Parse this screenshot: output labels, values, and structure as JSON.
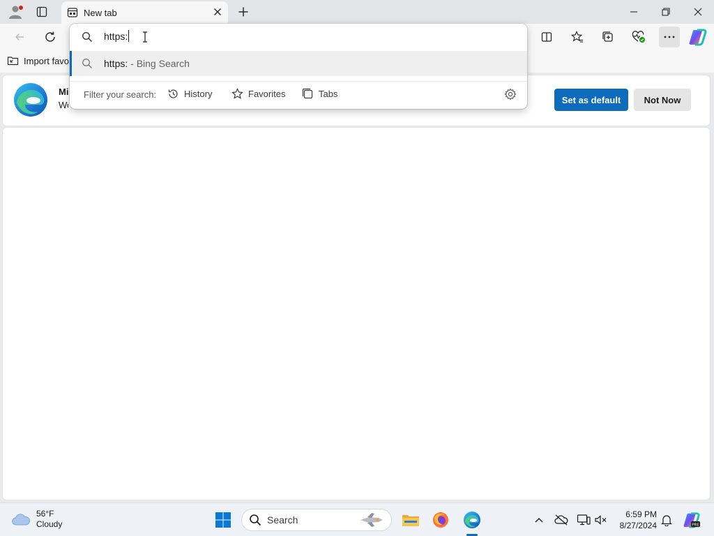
{
  "tab": {
    "title": "New tab"
  },
  "favorites_bar": {
    "import_label": "Import favor"
  },
  "banner": {
    "line1": "Microsoft Edge",
    "line2": "Wo",
    "set_default_label": "Set as default",
    "not_now_label": "Not Now"
  },
  "omnibox": {
    "input_value": "https:",
    "suggestion": {
      "query": "https:",
      "provider": " - Bing Search"
    },
    "filter_label": "Filter your search:",
    "filters": [
      {
        "label": "History",
        "icon": "history-icon"
      },
      {
        "label": "Favorites",
        "icon": "star-icon"
      },
      {
        "label": "Tabs",
        "icon": "tabs-icon"
      }
    ]
  },
  "taskbar": {
    "weather": {
      "temp": "56°F",
      "condition": "Cloudy"
    },
    "search_label": "Search",
    "time": "6:59 PM",
    "date": "8/27/2024"
  },
  "colors": {
    "accent": "#0f6cbd",
    "profile_badge": "#c42b1c"
  }
}
